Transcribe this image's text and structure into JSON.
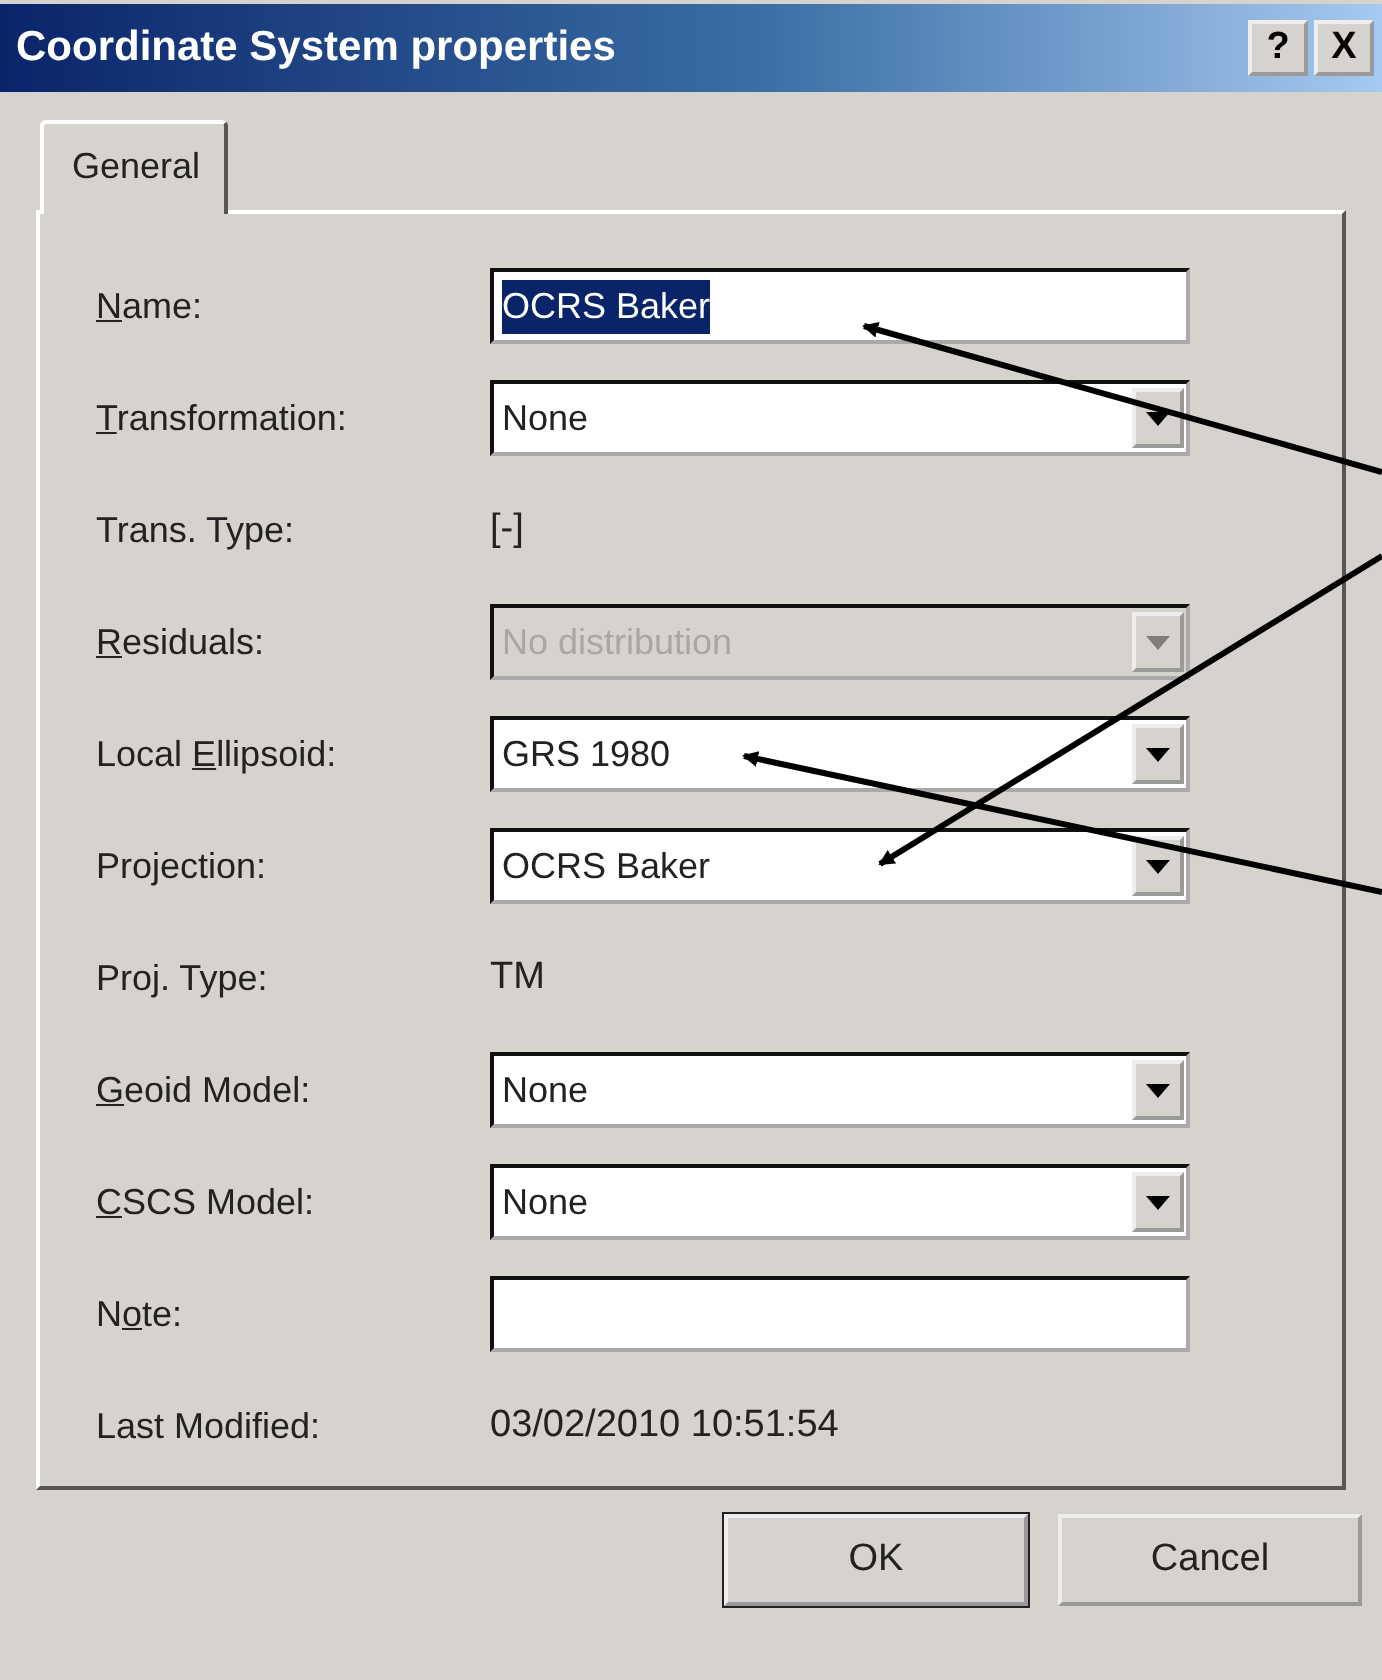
{
  "window": {
    "title": "Coordinate System properties",
    "buttons": [
      {
        "label": "?"
      },
      {
        "label": "X"
      }
    ]
  },
  "tabs": [
    {
      "label": "General",
      "selected": true
    }
  ],
  "fields": [
    {
      "kind": "text",
      "label": {
        "key": "N",
        "post": "ame:"
      },
      "value": "OCRS Baker",
      "text_selected": true
    },
    {
      "kind": "combo",
      "label": {
        "key": "T",
        "post": "ransformation:"
      },
      "value": "None",
      "disabled": false
    },
    {
      "kind": "static",
      "label": {
        "pre": "Trans. Type:"
      },
      "value": "[-]"
    },
    {
      "kind": "combo",
      "label": {
        "key": "R",
        "post": "esiduals:"
      },
      "value": "No distribution",
      "disabled": true
    },
    {
      "kind": "combo",
      "label": {
        "pre": "Local ",
        "key": "E",
        "post": "llipsoid:"
      },
      "value": "GRS 1980",
      "disabled": false
    },
    {
      "kind": "combo",
      "label": {
        "pre": "Projection:"
      },
      "value": "OCRS Baker",
      "disabled": false
    },
    {
      "kind": "static",
      "label": {
        "pre": "Proj. Type:"
      },
      "value": "TM"
    },
    {
      "kind": "combo",
      "label": {
        "key": "G",
        "post": "eoid Model:"
      },
      "value": "None",
      "disabled": false
    },
    {
      "kind": "combo",
      "label": {
        "key": "C",
        "post": "SCS Model:"
      },
      "value": "None",
      "disabled": false
    },
    {
      "kind": "text",
      "label": {
        "pre": "N",
        "key": "o",
        "post": "te:"
      }
    },
    {
      "kind": "static",
      "label": {
        "pre": "Last Modified:"
      },
      "value": "03/02/2010 10:51:54"
    }
  ],
  "buttons": [
    {
      "label": "OK",
      "default": true
    },
    {
      "label": "Cancel",
      "default": false
    }
  ]
}
